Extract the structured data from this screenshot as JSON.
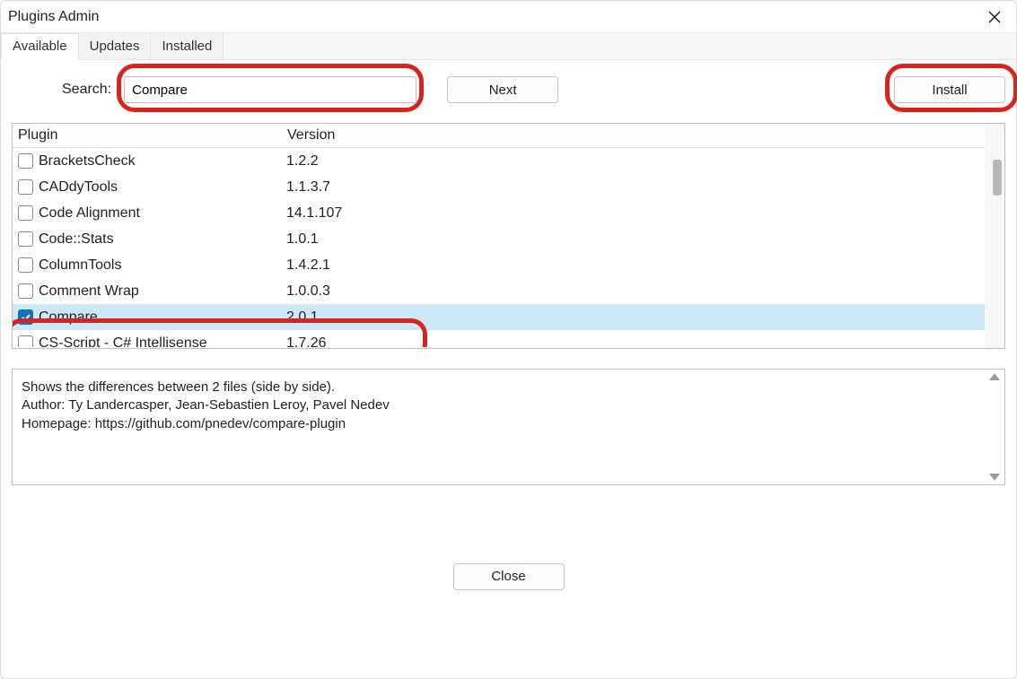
{
  "window": {
    "title": "Plugins Admin"
  },
  "tabs": [
    {
      "label": "Available",
      "active": true
    },
    {
      "label": "Updates",
      "active": false
    },
    {
      "label": "Installed",
      "active": false
    }
  ],
  "search": {
    "label": "Search:",
    "value": "Compare",
    "next_label": "Next",
    "install_label": "Install"
  },
  "columns": {
    "plugin": "Plugin",
    "version": "Version"
  },
  "plugins": [
    {
      "name": "BracketsCheck",
      "version": "1.2.2",
      "checked": false,
      "selected": false
    },
    {
      "name": "CADdyTools",
      "version": "1.1.3.7",
      "checked": false,
      "selected": false
    },
    {
      "name": "Code Alignment",
      "version": "14.1.107",
      "checked": false,
      "selected": false
    },
    {
      "name": "Code::Stats",
      "version": "1.0.1",
      "checked": false,
      "selected": false
    },
    {
      "name": "ColumnTools",
      "version": "1.4.2.1",
      "checked": false,
      "selected": false
    },
    {
      "name": "Comment Wrap",
      "version": "1.0.0.3",
      "checked": false,
      "selected": false
    },
    {
      "name": "Compare",
      "version": "2.0.1",
      "checked": true,
      "selected": true
    },
    {
      "name": "CS-Script - C# Intellisense",
      "version": "1.7.26",
      "checked": false,
      "selected": false
    }
  ],
  "description": {
    "line1": "Shows the differences between 2 files (side by side).",
    "line2": "Author: Ty Landercasper, Jean-Sebastien Leroy, Pavel Nedev",
    "line3": "Homepage: https://github.com/pnedev/compare-plugin"
  },
  "footer": {
    "close_label": "Close"
  }
}
